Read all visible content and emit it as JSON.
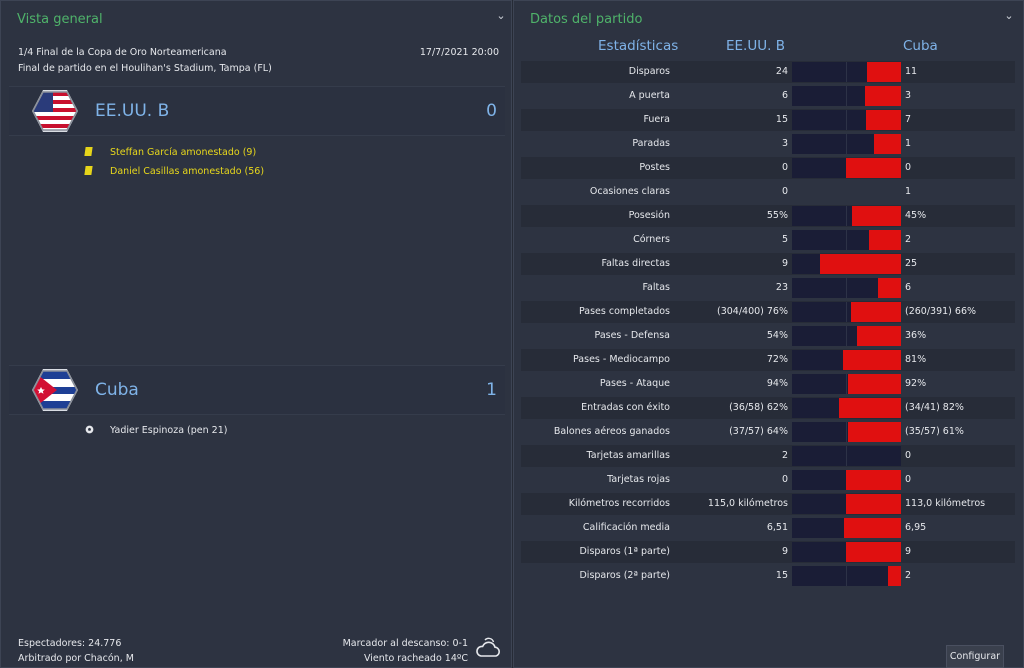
{
  "overview": {
    "title": "Vista general",
    "competition": "1/4 Final de la Copa de Oro Norteamericana",
    "datetime": "17/7/2021 20:00",
    "venue": "Final de partido en el Houlihan's Stadium, Tampa (FL)",
    "home": {
      "name": "EE.UU. B",
      "score": "0",
      "events": [
        {
          "type": "yellow-card",
          "text": "Steffan García amonestado (9)"
        },
        {
          "type": "yellow-card",
          "text": "Daniel Casillas amonestado (56)"
        }
      ]
    },
    "away": {
      "name": "Cuba",
      "score": "1",
      "events": [
        {
          "type": "goal",
          "text": "Yadier Espinoza (pen 21)"
        }
      ]
    },
    "footer": {
      "attendance": "Espectadores: 24.776",
      "referee": "Arbitrado por Chacón, M",
      "halftime": "Marcador al descanso: 0-1",
      "weather": "Viento racheado 14ºC"
    }
  },
  "stats": {
    "title": "Datos del partido",
    "header_label": "Estadísticas",
    "home_team": "EE.UU. B",
    "away_team": "Cuba",
    "configure_label": "Configurar",
    "colors": {
      "home_bar": "#1a1d36",
      "away_bar": "#e01010",
      "header": "#7fb3e8",
      "title": "#4fb36a"
    },
    "rows": [
      {
        "label": "Disparos",
        "home": "24",
        "away": "11",
        "away_share": 0.31
      },
      {
        "label": "A puerta",
        "home": "6",
        "away": "3",
        "away_share": 0.33
      },
      {
        "label": "Fuera",
        "home": "15",
        "away": "7",
        "away_share": 0.32
      },
      {
        "label": "Paradas",
        "home": "3",
        "away": "1",
        "away_share": 0.25
      },
      {
        "label": "Postes",
        "home": "0",
        "away": "0",
        "away_share": 0.5
      },
      {
        "label": "Ocasiones claras",
        "home": "0",
        "away": "1",
        "away_share": null
      },
      {
        "label": "Posesión",
        "home": "55%",
        "away": "45%",
        "away_share": 0.45
      },
      {
        "label": "Córners",
        "home": "5",
        "away": "2",
        "away_share": 0.29
      },
      {
        "label": "Faltas directas",
        "home": "9",
        "away": "25",
        "away_share": 0.74
      },
      {
        "label": "Faltas",
        "home": "23",
        "away": "6",
        "away_share": 0.21
      },
      {
        "label": "Pases completados",
        "home": "(304/400) 76%",
        "away": "(260/391) 66%",
        "away_share": 0.46
      },
      {
        "label": "Pases - Defensa",
        "home": "54%",
        "away": "36%",
        "away_share": 0.4
      },
      {
        "label": "Pases - Mediocampo",
        "home": "72%",
        "away": "81%",
        "away_share": 0.53
      },
      {
        "label": "Pases - Ataque",
        "home": "94%",
        "away": "92%",
        "away_share": 0.49
      },
      {
        "label": "Entradas con éxito",
        "home": "(36/58) 62%",
        "away": "(34/41) 82%",
        "away_share": 0.57
      },
      {
        "label": "Balones aéreos ganados",
        "home": "(37/57) 64%",
        "away": "(35/57) 61%",
        "away_share": 0.49
      },
      {
        "label": "Tarjetas amarillas",
        "home": "2",
        "away": "0",
        "away_share": 0.0
      },
      {
        "label": "Tarjetas rojas",
        "home": "0",
        "away": "0",
        "away_share": 0.5
      },
      {
        "label": "Kilómetros recorridos",
        "home": "115,0 kilómetros",
        "away": "113,0 kilómetros",
        "away_share": 0.5
      },
      {
        "label": "Calificación media",
        "home": "6,51",
        "away": "6,95",
        "away_share": 0.52
      },
      {
        "label": "Disparos (1ª parte)",
        "home": "9",
        "away": "9",
        "away_share": 0.5
      },
      {
        "label": "Disparos (2ª parte)",
        "home": "15",
        "away": "2",
        "away_share": 0.12
      }
    ]
  }
}
